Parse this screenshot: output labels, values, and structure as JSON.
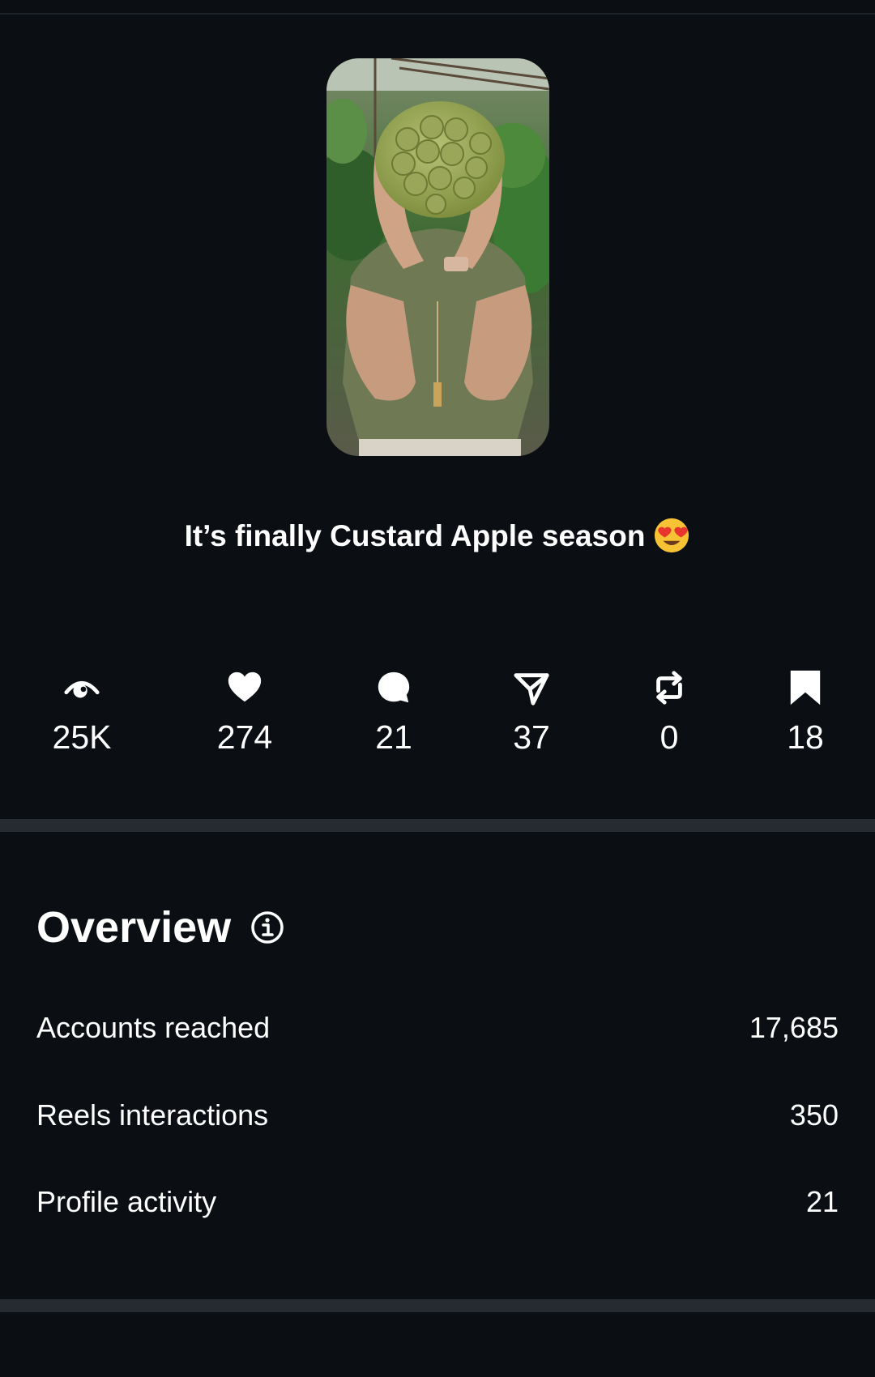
{
  "reel": {
    "caption": "It’s finally Custard Apple season",
    "caption_emoji": "heart-eyes-emoji"
  },
  "stats": [
    {
      "icon": "eye-icon",
      "value": "25K"
    },
    {
      "icon": "heart-icon",
      "value": "274"
    },
    {
      "icon": "comment-icon",
      "value": "21"
    },
    {
      "icon": "share-icon",
      "value": "37"
    },
    {
      "icon": "repost-icon",
      "value": "0"
    },
    {
      "icon": "bookmark-icon",
      "value": "18"
    }
  ],
  "overview": {
    "title": "Overview",
    "info_icon": "info-icon",
    "rows": [
      {
        "label": "Accounts reached",
        "value": "17,685"
      },
      {
        "label": "Reels interactions",
        "value": "350"
      },
      {
        "label": "Profile activity",
        "value": "21"
      }
    ]
  },
  "colors": {
    "background": "#0b0f14",
    "divider": "#262b31",
    "text": "#ffffff"
  }
}
